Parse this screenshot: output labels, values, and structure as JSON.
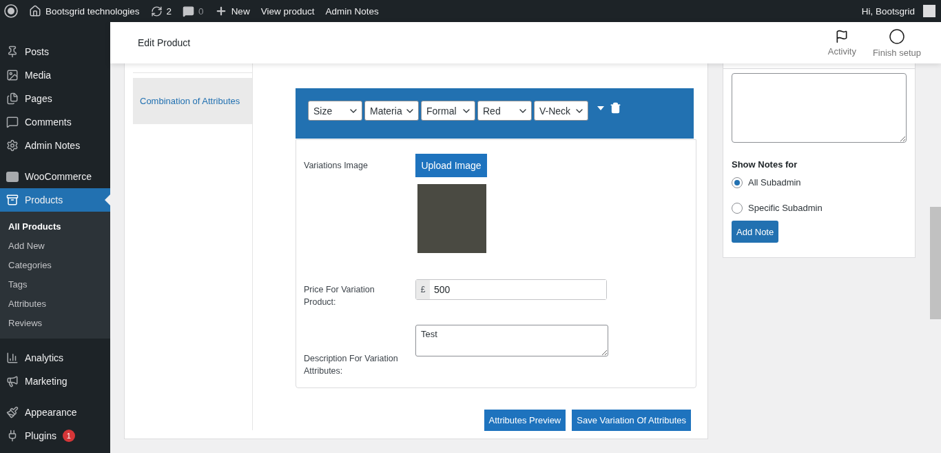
{
  "admin_bar": {
    "site_name": "Bootsgrid technologies",
    "updates": "2",
    "comments": "0",
    "new_label": "New",
    "links": [
      "View product",
      "Admin Notes"
    ],
    "greeting": "Hi, Bootsgrid"
  },
  "sidebar": {
    "groups": [
      [
        {
          "label": "Posts",
          "selected": false
        },
        {
          "label": "Media",
          "selected": false
        },
        {
          "label": "Pages",
          "selected": false
        },
        {
          "label": "Comments",
          "selected": false
        },
        {
          "label": "Admin Notes",
          "selected": false
        }
      ],
      [
        {
          "label": "WooCommerce",
          "selected": false
        },
        {
          "label": "Products",
          "selected": true,
          "children": [
            {
              "label": "All Products",
              "selected": true
            },
            {
              "label": "Add New",
              "selected": false
            },
            {
              "label": "Categories",
              "selected": false
            },
            {
              "label": "Tags",
              "selected": false
            },
            {
              "label": "Attributes",
              "selected": false
            },
            {
              "label": "Reviews",
              "selected": false
            }
          ]
        }
      ],
      [
        {
          "label": "Analytics",
          "selected": false
        },
        {
          "label": "Marketing",
          "selected": false
        }
      ],
      [
        {
          "label": "Appearance",
          "selected": false
        },
        {
          "label": "Plugins",
          "selected": false,
          "badge": "1"
        }
      ]
    ]
  },
  "header": {
    "title": "Edit Product",
    "actions": [
      "Activity",
      "Finish setup"
    ]
  },
  "tabs": [
    {
      "label": "Combination of Attributes",
      "selected": true
    }
  ],
  "variation": {
    "selects": [
      "Size",
      "Materia",
      "Formal",
      "Red",
      "V-Neck"
    ],
    "image_label": "Variations Image",
    "upload_button": "Upload Image",
    "price_label": "Price For Variation Product:",
    "currency": "£",
    "price": "500",
    "description_label": "Description For Variation Attributes:",
    "description": "Test"
  },
  "buttons": [
    "Attributes Preview",
    "Save Variation Of Attributes"
  ],
  "notes_panel": {
    "show_for_label": "Show Notes for",
    "options": [
      {
        "label": "All Subadmin",
        "selected": true
      },
      {
        "label": "Specific Subadmin",
        "selected": false
      }
    ],
    "button": "Add Note"
  }
}
